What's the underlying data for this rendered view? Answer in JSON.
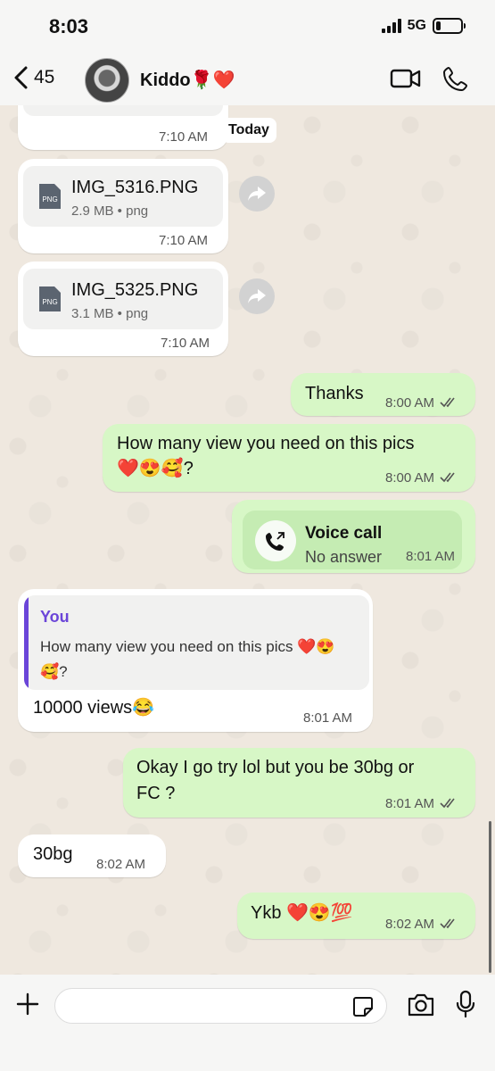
{
  "status": {
    "time": "8:03",
    "network": "5G"
  },
  "header": {
    "back_count": "45",
    "contact_name": "Kiddo🌹❤️"
  },
  "day_label": "Today",
  "messages": [
    {
      "dir": "in",
      "type": "file",
      "time": "7:10 AM",
      "partial": true
    },
    {
      "dir": "in",
      "type": "file",
      "file_name": "IMG_5316.PNG",
      "meta": "2.9 MB • png",
      "time": "7:10 AM"
    },
    {
      "dir": "in",
      "type": "file",
      "file_name": "IMG_5325.PNG",
      "meta": "3.1 MB • png",
      "time": "7:10 AM"
    },
    {
      "dir": "out",
      "type": "text",
      "text": "Thanks",
      "time": "8:00 AM"
    },
    {
      "dir": "out",
      "type": "text",
      "text_line1": "How many view you need on this pics",
      "text_line2": "❤️😍🥰?",
      "time": "8:00 AM"
    },
    {
      "dir": "out",
      "type": "call",
      "title": "Voice call",
      "subtitle": "No answer",
      "time": "8:01 AM"
    },
    {
      "dir": "in",
      "type": "reply",
      "quote_author": "You",
      "quote_text": "How many view you need on this pics ❤️😍🥰?",
      "text": "10000 views😂",
      "time": "8:01 AM"
    },
    {
      "dir": "out",
      "type": "text",
      "text_line1": "Okay I go try lol but you be 30bg or",
      "text_line2": "FC ?",
      "time": "8:01 AM"
    },
    {
      "dir": "in",
      "type": "text",
      "text": "30bg",
      "time": "8:02 AM"
    },
    {
      "dir": "out",
      "type": "text",
      "text": "Ykb ❤️😍💯",
      "time": "8:02 AM"
    }
  ],
  "composer": {
    "placeholder": ""
  },
  "colors": {
    "outgoing": "#d7f7c6",
    "incoming": "#ffffff",
    "accent": "#6b45d8"
  },
  "icons": [
    "back-chevron-icon",
    "video-call-icon",
    "phone-icon",
    "forward-icon",
    "png-file-icon",
    "double-check-icon",
    "missed-call-icon",
    "plus-icon",
    "sticker-icon",
    "camera-icon",
    "microphone-icon"
  ]
}
